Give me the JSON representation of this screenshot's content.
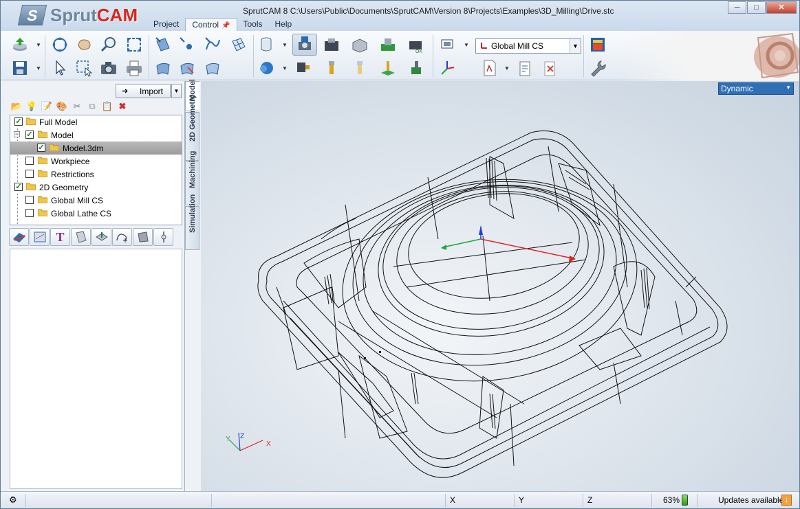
{
  "app": {
    "logo_prefix": "Sprut",
    "logo_suffix": "CAM",
    "window_title": "SprutCAM 8   C:\\Users\\Public\\Documents\\SprutCAM\\Version 8\\Projects\\Examples\\3D_Milling\\Drive.stc"
  },
  "menu": [
    "Project",
    "Control",
    "Tools",
    "Help"
  ],
  "window_controls": [
    "─",
    "□",
    "✕"
  ],
  "toolbar": {
    "coordinate_system": "Global Mill CS",
    "icons": [
      "import-icon",
      "rotate-view-icon",
      "pan-hand-icon",
      "zoom-icon",
      "zoom-fit-icon",
      "surface-select-icon",
      "point-select-icon",
      "curve-icon",
      "mesh-icon",
      "save-icon",
      "pointer-icon",
      "rect-select-icon",
      "camera-icon",
      "printer-icon",
      "surface-a-icon",
      "surface-b-icon",
      "surface-c-icon",
      "cylinder-icon",
      "solid-icon",
      "machine-1-icon",
      "machine-2-icon",
      "machine-3-icon",
      "machine-4-icon",
      "machine-5-icon",
      "tool-1-icon",
      "tool-2-icon",
      "tool-3-icon",
      "tool-4-icon",
      "tool-5-icon",
      "workpiece-icon",
      "axis-icon",
      "pdf-icon",
      "report-icon",
      "close-doc-icon",
      "color-icon",
      "wrench-icon"
    ]
  },
  "left_panel": {
    "import_label": "Import",
    "tree": [
      {
        "label": "Full Model",
        "checked": true,
        "level": 0,
        "expandable": false,
        "selected": false
      },
      {
        "label": "Model",
        "checked": true,
        "level": 1,
        "expandable": true,
        "selected": false
      },
      {
        "label": "Model.3dm",
        "checked": true,
        "level": 2,
        "expandable": false,
        "selected": true
      },
      {
        "label": "Workpiece",
        "checked": false,
        "level": 1,
        "expandable": false,
        "selected": false
      },
      {
        "label": "Restrictions",
        "checked": false,
        "level": 1,
        "expandable": false,
        "selected": false
      },
      {
        "label": "2D Geometry",
        "checked": true,
        "level": 0,
        "expandable": false,
        "selected": false
      },
      {
        "label": "Global Mill CS",
        "checked": false,
        "level": 1,
        "expandable": false,
        "selected": false
      },
      {
        "label": "Global Lathe CS",
        "checked": false,
        "level": 1,
        "expandable": false,
        "selected": false
      }
    ],
    "vertical_tabs": [
      "Model",
      "2D Geometry",
      "Machining",
      "Simulation"
    ]
  },
  "viewport": {
    "view_mode": "Dynamic",
    "axis_labels": {
      "x": "X",
      "y": "Y",
      "z": "Z"
    },
    "colors": {
      "x_axis": "#e0231c",
      "y_axis": "#19a83a",
      "z_axis": "#1f3fd6",
      "wire": "#111111"
    }
  },
  "status_bar": {
    "x_label": "X",
    "y_label": "Y",
    "z_label": "Z",
    "memory": "63%",
    "updates": "Updates available"
  }
}
